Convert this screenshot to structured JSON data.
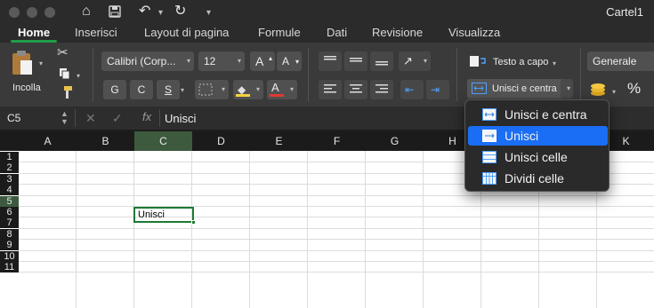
{
  "window": {
    "title": "Cartel1"
  },
  "quick_access": {
    "icons": [
      "home-icon",
      "save-icon",
      "undo-icon",
      "redo-icon",
      "customize-icon"
    ]
  },
  "tabs": [
    {
      "label": "Home",
      "active": true
    },
    {
      "label": "Inserisci"
    },
    {
      "label": "Layout di pagina"
    },
    {
      "label": "Formule"
    },
    {
      "label": "Dati"
    },
    {
      "label": "Revisione"
    },
    {
      "label": "Visualizza"
    }
  ],
  "ribbon": {
    "paste_label": "Incolla",
    "font_name": "Calibri (Corp...",
    "font_size": "12",
    "grow_font": "A",
    "shrink_font": "A",
    "bold": "G",
    "italic": "C",
    "underline": "S",
    "wrap_text": "Testo a capo",
    "merge_center": "Unisci e centra",
    "number_format": "Generale",
    "percent": "%"
  },
  "formula_bar": {
    "cell_ref": "C5",
    "fx": "fx",
    "content": "Unisci"
  },
  "grid": {
    "columns": [
      "A",
      "B",
      "C",
      "D",
      "E",
      "F",
      "G",
      "H",
      "I",
      "J",
      "K"
    ],
    "rows": [
      "1",
      "2",
      "3",
      "4",
      "5",
      "6",
      "7",
      "8",
      "9",
      "10",
      "11"
    ],
    "selected_cell": "C5",
    "selected_value": "Unisci"
  },
  "merge_menu": {
    "items": [
      {
        "label": "Unisci e centra",
        "icon": "merge-center-icon"
      },
      {
        "label": "Unisci",
        "icon": "merge-across-icon",
        "highlighted": true
      },
      {
        "label": "Unisci celle",
        "icon": "merge-cells-icon"
      },
      {
        "label": "Dividi celle",
        "icon": "unmerge-cells-icon"
      }
    ]
  },
  "colors": {
    "accent_green": "#1f9e4a",
    "menu_highlight": "#1a6ef5",
    "fill_yellow": "#f5d33a",
    "font_red": "#e03a2f"
  }
}
